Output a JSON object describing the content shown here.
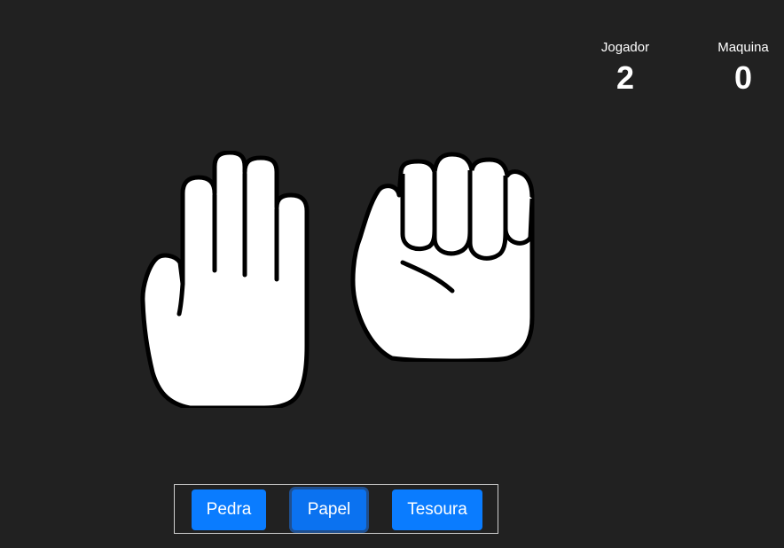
{
  "scoreboard": {
    "player_label": "Jogador",
    "player_score": "2",
    "machine_label": "Maquina",
    "machine_score": "0"
  },
  "hands": {
    "player_choice": "paper-hand-icon",
    "machine_choice": "rock-fist-icon"
  },
  "controls": {
    "rock_label": "Pedra",
    "paper_label": "Papel",
    "scissors_label": "Tesoura",
    "selected": "Papel",
    "button_color": "#0a7cff"
  },
  "theme": {
    "background": "#212121",
    "text": "#ffffff"
  }
}
